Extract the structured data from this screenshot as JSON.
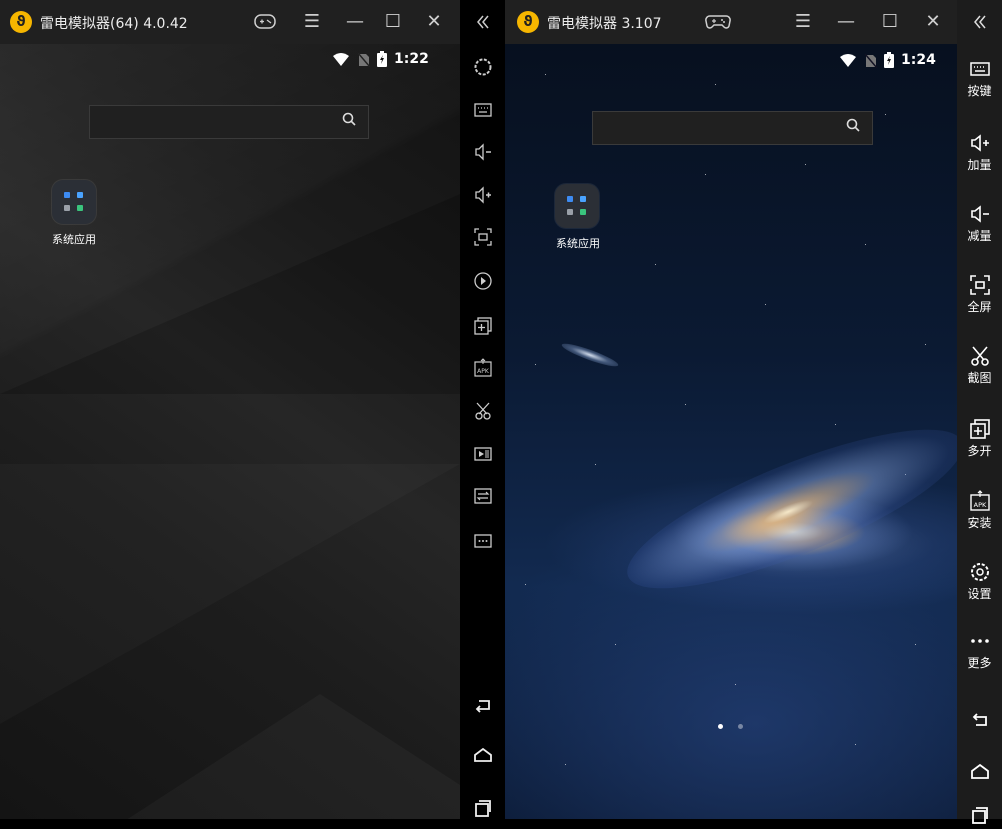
{
  "window1": {
    "title": "雷电模拟器(64) 4.0.42",
    "logo": "lightning-logo",
    "time": "1:22",
    "search_placeholder": "",
    "app_folder_label": "系统应用"
  },
  "window2": {
    "title": "雷电模拟器 3.107",
    "logo": "lightning-logo",
    "time": "1:24",
    "search_placeholder": "",
    "app_folder_label": "系统应用",
    "page_dots": 2,
    "active_page": 1
  },
  "sidebar": {
    "items": [
      {
        "label": "按键",
        "icon": "keyboard-icon"
      },
      {
        "label": "加量",
        "icon": "volume-up-icon"
      },
      {
        "label": "减量",
        "icon": "volume-down-icon"
      },
      {
        "label": "全屏",
        "icon": "fullscreen-icon"
      },
      {
        "label": "截图",
        "icon": "scissors-icon"
      },
      {
        "label": "多开",
        "icon": "multi-instance-icon"
      },
      {
        "label": "安装",
        "icon": "apk-install-icon"
      },
      {
        "label": "设置",
        "icon": "gear-icon"
      },
      {
        "label": "更多",
        "icon": "more-icon"
      }
    ]
  },
  "colors": {
    "titlebar": "#202020",
    "sidebar": "#1c1c1c",
    "logo": "#f6b600"
  }
}
